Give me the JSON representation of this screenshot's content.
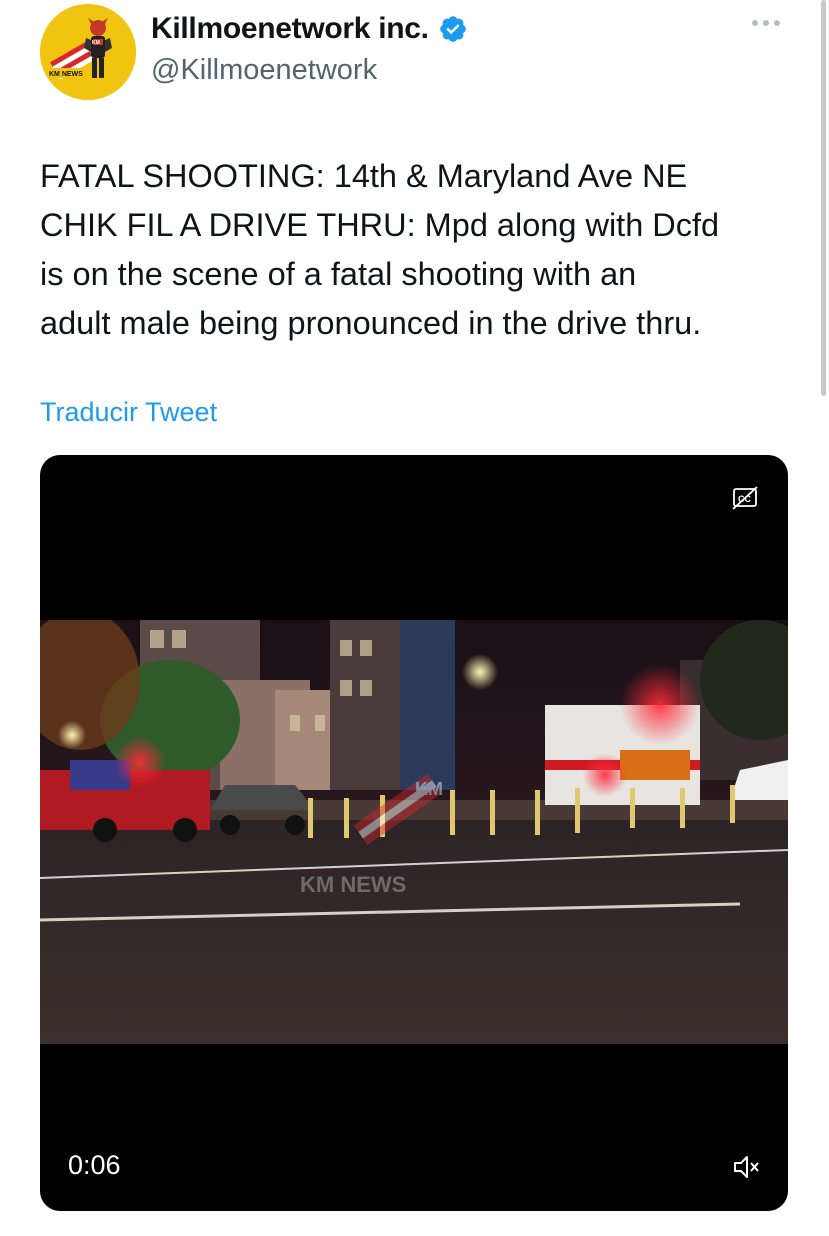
{
  "author": {
    "display_name": "Killmoenetwork inc.",
    "handle": "@Killmoenetwork",
    "avatar_label": "KM NEWS",
    "verified": true
  },
  "tweet": {
    "text_lines": [
      "FATAL SHOOTING: 14th & Maryland Ave NE",
      "CHIK FIL A DRIVE THRU: Mpd along with Dcfd",
      "is on the scene of a fatal shooting with an",
      "adult male being pronounced in the drive thru."
    ],
    "translate_label": "Traducir Tweet"
  },
  "video": {
    "time": "0:06",
    "watermark": "KM NEWS",
    "watermark_logo": "KM",
    "cc_icon": "closed-captions-off-icon",
    "mute_icon": "speaker-muted-icon"
  },
  "colors": {
    "link": "#1d9bf0",
    "verified": "#1d9bf0",
    "text": "#0f1419",
    "secondary": "#536471",
    "avatar_bg": "#f1c40f"
  }
}
